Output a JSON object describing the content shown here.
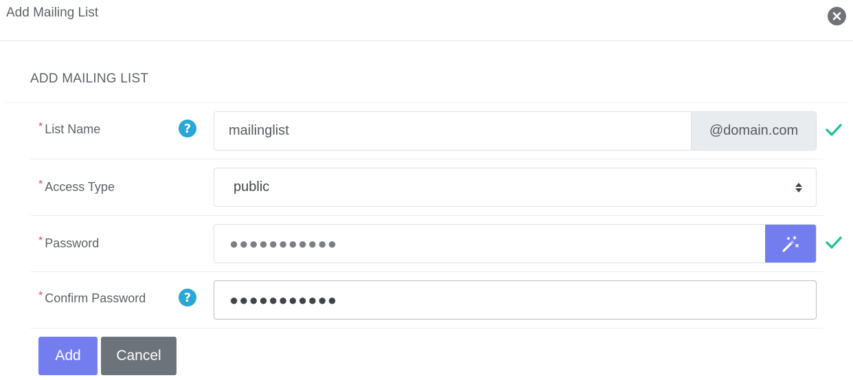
{
  "modal": {
    "title": "Add Mailing List"
  },
  "section": {
    "title": "ADD MAILING LIST"
  },
  "fields": {
    "list_name": {
      "label": "List Name",
      "required_mark": "*",
      "value": "mailinglist",
      "addon": "@domain.com"
    },
    "access_type": {
      "label": "Access Type",
      "required_mark": "*",
      "selected": "public"
    },
    "password": {
      "label": "Password",
      "required_mark": "*",
      "masked_value": "●●●●●●●●●●●"
    },
    "confirm_password": {
      "label": "Confirm Password",
      "required_mark": "*",
      "masked_value": "●●●●●●●●●●●"
    }
  },
  "help_glyph": "?",
  "buttons": {
    "add": "Add",
    "cancel": "Cancel"
  },
  "colors": {
    "primary": "#737df0",
    "secondary": "#6c737b",
    "required": "#e5484d",
    "help": "#29a7d8",
    "success": "#1fc495"
  },
  "icons": {
    "close": "close-icon",
    "help": "question-icon",
    "check": "check-icon",
    "wand": "magic-wand-icon",
    "select": "sort-arrows-icon"
  }
}
